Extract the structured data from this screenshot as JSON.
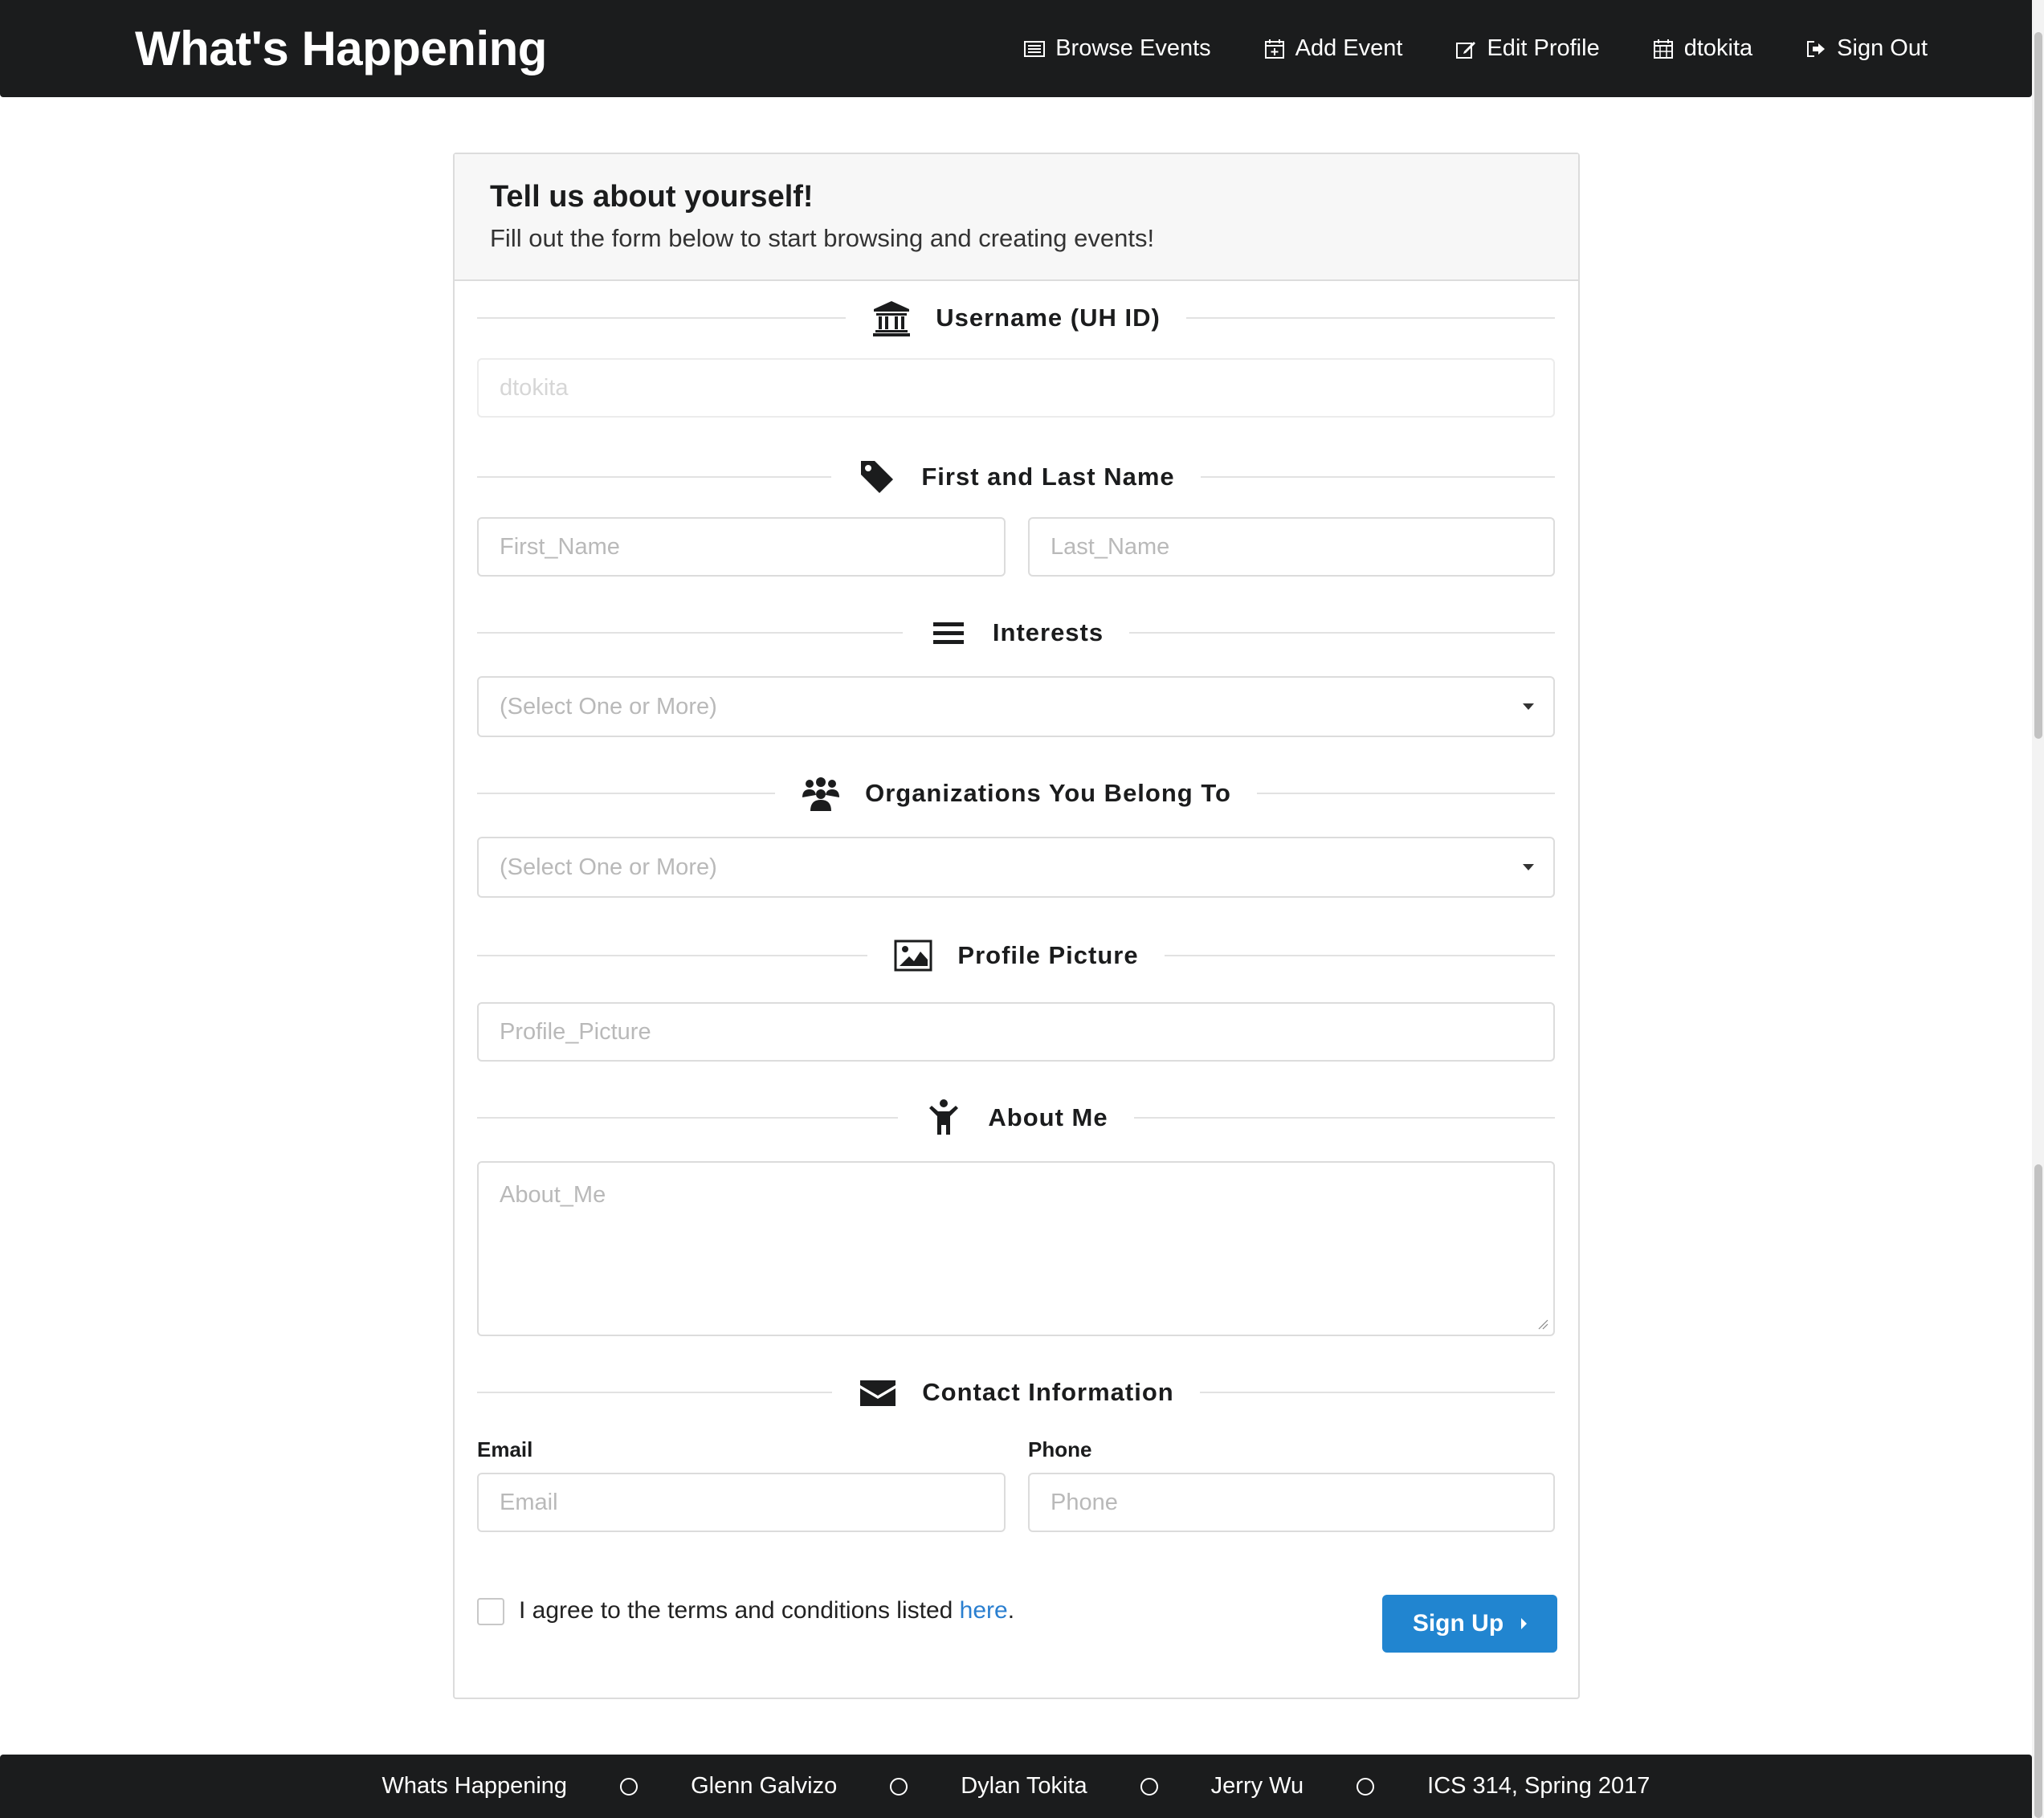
{
  "nav": {
    "brand": "What's Happening",
    "items": [
      {
        "label": "Browse Events",
        "icon": "list-icon"
      },
      {
        "label": "Add Event",
        "icon": "calendar-plus-icon"
      },
      {
        "label": "Edit Profile",
        "icon": "edit-icon"
      },
      {
        "label": "dtokita",
        "icon": "calendar-icon"
      },
      {
        "label": "Sign Out",
        "icon": "sign-out-icon"
      }
    ]
  },
  "form": {
    "title": "Tell us about yourself!",
    "subtitle": "Fill out the form below to start browsing and creating events!",
    "sections": {
      "username": "Username (UH ID)",
      "name": "First and Last Name",
      "interests": "Interests",
      "organizations": "Organizations You Belong To",
      "picture": "Profile Picture",
      "about": "About Me",
      "contact": "Contact Information"
    },
    "fields": {
      "username": "dtokita",
      "first_name": "First_Name",
      "last_name": "Last_Name",
      "interests": "(Select One or More)",
      "organizations": "(Select One or More)",
      "profile_picture": "Profile_Picture",
      "about_me": "About_Me",
      "email_label": "Email",
      "email": "Email",
      "phone_label": "Phone",
      "phone": "Phone"
    },
    "agree_prefix": "I agree to the terms and conditions listed ",
    "agree_link": "here",
    "agree_suffix": ".",
    "submit": "Sign Up"
  },
  "footer": {
    "items": [
      "Whats Happening",
      "Glenn Galvizo",
      "Dylan Tokita",
      "Jerry Wu",
      "ICS 314, Spring 2017"
    ]
  },
  "colors": {
    "nav_bg": "#1b1c1d",
    "primary": "#2185d0",
    "link": "#2a7fd0"
  }
}
